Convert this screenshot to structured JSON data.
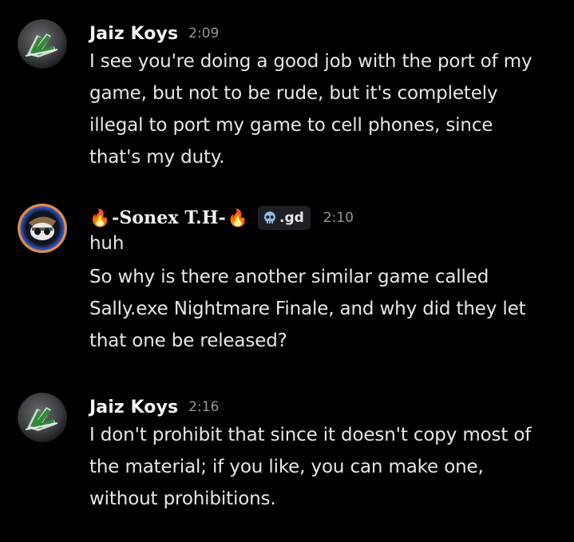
{
  "messages": [
    {
      "author": "Jaiz Koys",
      "time": "2:09",
      "avatar_icon": "jk-logo-icon",
      "lines": [
        "I see you're doing a good job with the port of my",
        "game, but not to be rude, but it's completely",
        "illegal to port my game to cell phones, since",
        "that's my duty."
      ]
    },
    {
      "author_prefix": "🔥",
      "author": "-Sonex T.H-",
      "author_suffix": "🔥",
      "tag_icon": "skull-icon",
      "tag": ".gd",
      "time": "2:10",
      "avatar_icon": "masked-character-icon",
      "lines": [
        "huh",
        "So why is there another similar game called",
        "Sally.exe Nightmare Finale, and why did they let",
        "that one be released?"
      ]
    },
    {
      "author": "Jaiz Koys",
      "time": "2:16",
      "avatar_icon": "jk-logo-icon",
      "lines": [
        "I don't prohibit that since it doesn't copy most of",
        "the material; if you like, you can make one,",
        "without prohibitions."
      ]
    }
  ],
  "colors": {
    "background": "#000000",
    "username": "#f2f3f5",
    "timestamp": "#94959c",
    "text": "#e6e7ea",
    "tag_bg": "#1e1f24"
  }
}
